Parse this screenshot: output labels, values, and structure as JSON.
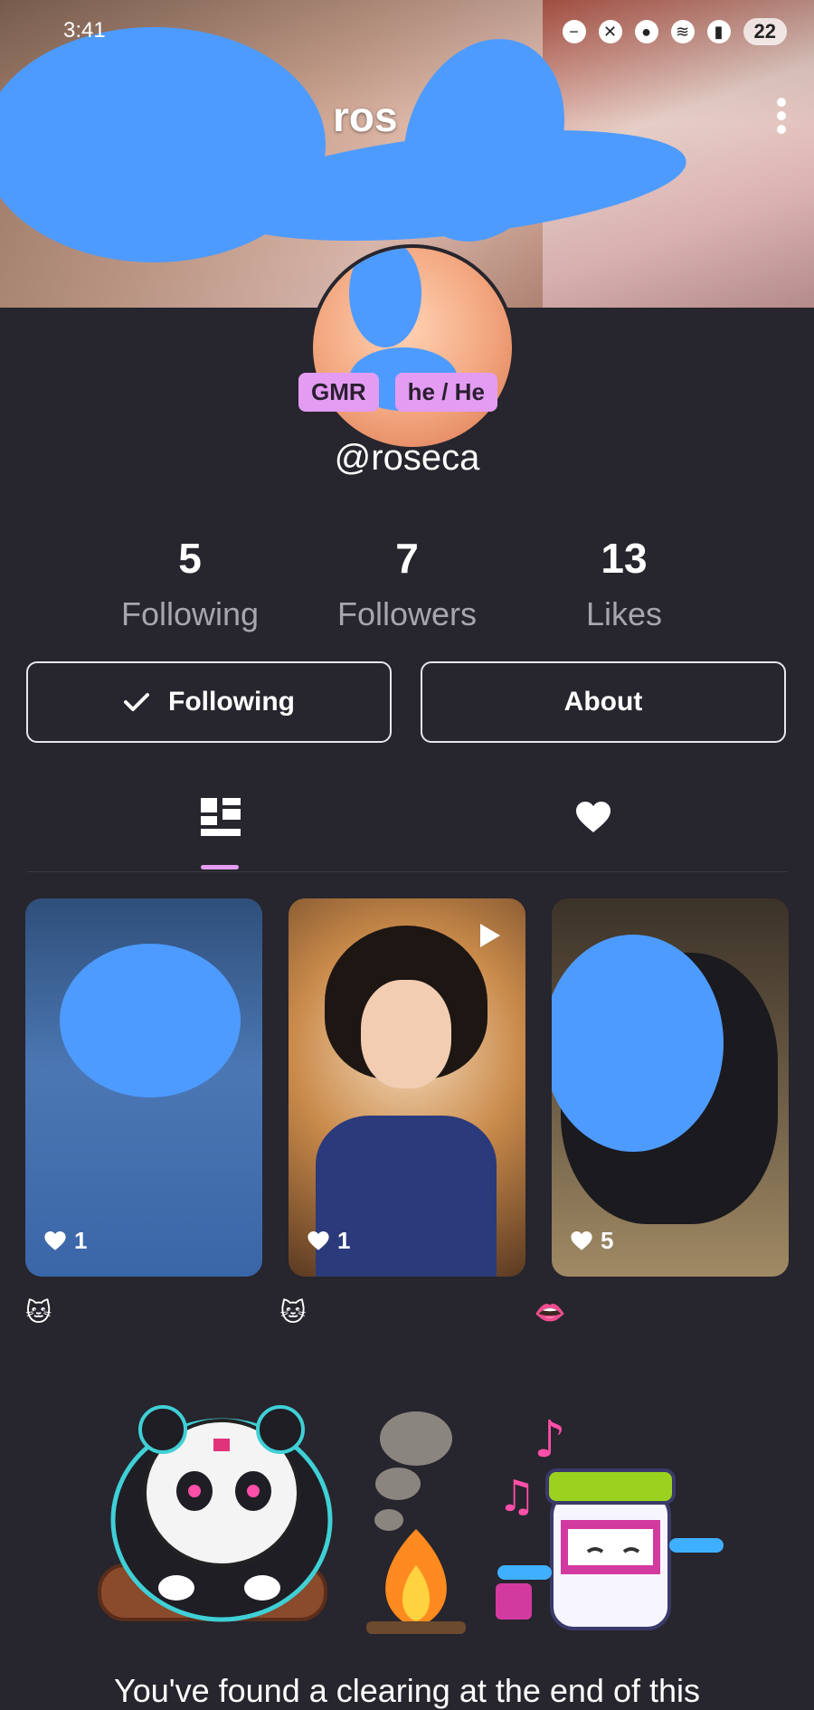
{
  "status_bar": {
    "time": "3:41",
    "battery": "22"
  },
  "header": {
    "title": "ros"
  },
  "profile": {
    "tags": [
      "GMR",
      "he / He"
    ],
    "handle": "@roseca"
  },
  "stats": [
    {
      "value": "5",
      "label": "Following"
    },
    {
      "value": "7",
      "label": "Followers"
    },
    {
      "value": "13",
      "label": "Likes"
    }
  ],
  "buttons": {
    "following_label": "Following",
    "about_label": "About"
  },
  "tabs": [
    {
      "icon": "grid-layout-icon",
      "active": true
    },
    {
      "icon": "heart-icon",
      "active": false
    }
  ],
  "posts": [
    {
      "likes": "1",
      "emoji": "🐱",
      "is_video": false
    },
    {
      "likes": "1",
      "emoji": "🐱",
      "is_video": true
    },
    {
      "likes": "5",
      "emoji": "👄",
      "is_video": false
    }
  ],
  "footer": {
    "message": "You've found a clearing at the end of this"
  },
  "colors": {
    "background": "#27252d",
    "accent": "#e39cf2",
    "muted_text": "#a8a6ad",
    "scribble": "#4e9bff"
  }
}
